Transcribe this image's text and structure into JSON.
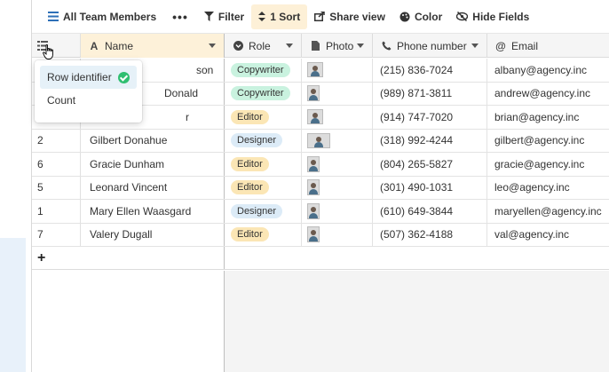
{
  "toolbar": {
    "view_label": "All Team Members",
    "more_label": "•••",
    "filter_label": "Filter",
    "sort_label": "1 Sort",
    "share_label": "Share view",
    "color_label": "Color",
    "hide_label": "Hide Fields"
  },
  "columns": {
    "name": "Name",
    "role": "Role",
    "photo": "Photo",
    "phone": "Phone number",
    "email": "Email"
  },
  "dropdown": {
    "items": [
      "Row identifier",
      "Count"
    ],
    "selected": "Row identifier"
  },
  "rows": [
    {
      "num": "",
      "name": "son",
      "role": "Copywriter",
      "role_color": "#c9f2df",
      "phone": "(215) 836-7024",
      "email": "albany@agency.inc"
    },
    {
      "num": "",
      "name": "Donald",
      "role": "Copywriter",
      "role_color": "#c9f2df",
      "phone": "(989) 871-3811",
      "email": "andrew@agency.inc"
    },
    {
      "num": "",
      "name": "r",
      "role": "Editor",
      "role_color": "#fbe6b5",
      "phone": "(914) 747-7020",
      "email": "brian@agency.inc"
    },
    {
      "num": "2",
      "name": "Gilbert Donahue",
      "role": "Designer",
      "role_color": "#dcebf7",
      "phone": "(318) 992-4244",
      "email": "gilbert@agency.inc"
    },
    {
      "num": "6",
      "name": "Gracie Dunham",
      "role": "Editor",
      "role_color": "#fbe6b5",
      "phone": "(804) 265-5827",
      "email": "gracie@agency.inc"
    },
    {
      "num": "5",
      "name": "Leonard Vincent",
      "role": "Editor",
      "role_color": "#fbe6b5",
      "phone": "(301) 490-1031",
      "email": "leo@agency.inc"
    },
    {
      "num": "1",
      "name": "Mary Ellen Waasgard",
      "role": "Designer",
      "role_color": "#dcebf7",
      "phone": "(610) 649-3844",
      "email": "maryellen@agency.inc"
    },
    {
      "num": "7",
      "name": "Valery Dugall",
      "role": "Editor",
      "role_color": "#fbe6b5",
      "phone": "(507) 362-4188",
      "email": "val@agency.inc"
    }
  ],
  "add_row_label": "+"
}
